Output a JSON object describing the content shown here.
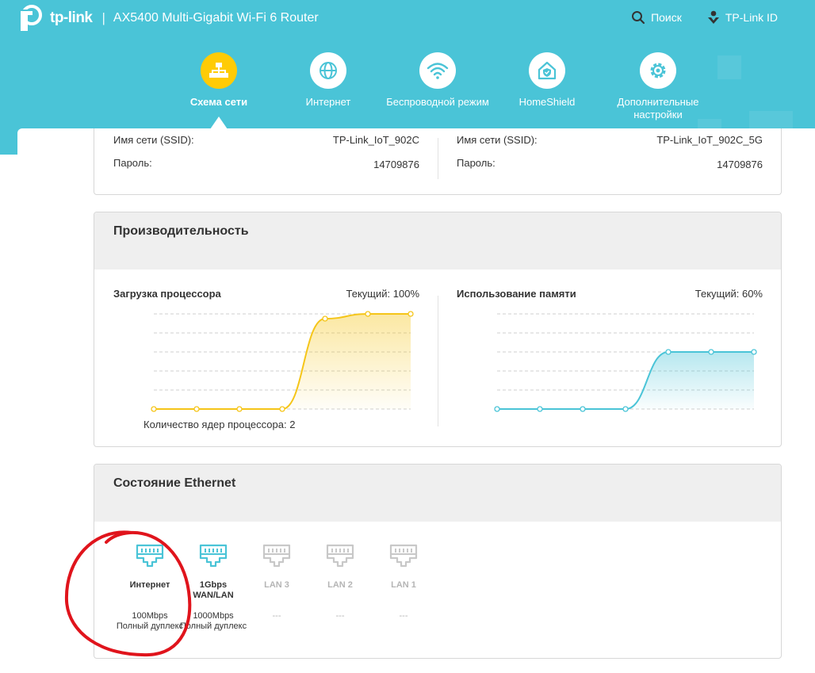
{
  "header": {
    "brand": "tp-link",
    "separator": "|",
    "model": "AX5400 Multi-Gigabit Wi-Fi 6 Router",
    "search_label": "Поиск",
    "account_label": "TP-Link ID"
  },
  "nav": {
    "items": [
      {
        "label": "Схема сети",
        "icon": "network-map-icon",
        "active": true
      },
      {
        "label": "Интернет",
        "icon": "globe-icon",
        "active": false
      },
      {
        "label": "Беспроводной режим",
        "icon": "wifi-icon",
        "active": false
      },
      {
        "label": "HomeShield",
        "icon": "home-shield-icon",
        "active": false
      },
      {
        "label": "Дополнительные настройки",
        "icon": "gear-icon",
        "active": false
      }
    ]
  },
  "wireless": {
    "band_24": {
      "ssid_label": "Имя сети (SSID):",
      "ssid": "TP-Link_IoT_902C",
      "password_label": "Пароль:",
      "password": "14709876"
    },
    "band_5": {
      "ssid_label": "Имя сети (SSID):",
      "ssid": "TP-Link_IoT_902C_5G",
      "password_label": "Пароль:",
      "password": "14709876"
    }
  },
  "performance": {
    "title": "Производительность",
    "cpu": {
      "title": "Загрузка процессора",
      "current": "Текущий: 100%",
      "cores": "Количество ядер процессора: 2"
    },
    "memory": {
      "title": "Использование памяти",
      "current": "Текущий: 60%"
    }
  },
  "chart_data": [
    {
      "type": "area",
      "title": "Загрузка процессора",
      "x": [
        1,
        2,
        3,
        4,
        5,
        6,
        7
      ],
      "values": [
        0,
        0,
        0,
        0,
        95,
        100,
        100
      ],
      "ylim": [
        0,
        100
      ],
      "color": "#f5c518",
      "grid": true
    },
    {
      "type": "area",
      "title": "Использование памяти",
      "x": [
        1,
        2,
        3,
        4,
        5,
        6,
        7
      ],
      "values": [
        0,
        0,
        0,
        0,
        60,
        60,
        60
      ],
      "ylim": [
        0,
        100
      ],
      "color": "#4ac4d7",
      "grid": true
    }
  ],
  "ethernet": {
    "title": "Состояние Ethernet",
    "ports": [
      {
        "name": "Интернет",
        "speed": "100Mbps",
        "duplex": "Полный дуплекс",
        "connected": true
      },
      {
        "name": "1Gbps WAN/LAN",
        "speed": "1000Mbps",
        "duplex": "Полный дуплекс",
        "connected": true
      },
      {
        "name": "LAN 3",
        "speed": "---",
        "duplex": "",
        "connected": false
      },
      {
        "name": "LAN 2",
        "speed": "---",
        "duplex": "",
        "connected": false
      },
      {
        "name": "LAN 1",
        "speed": "---",
        "duplex": "",
        "connected": false
      }
    ]
  },
  "colors": {
    "header_bg": "#4ac4d7",
    "active_nav": "#ffcb05",
    "port_on": "#4ac4d7",
    "port_off": "#c8c8c8",
    "annotation": "#e0141c"
  }
}
